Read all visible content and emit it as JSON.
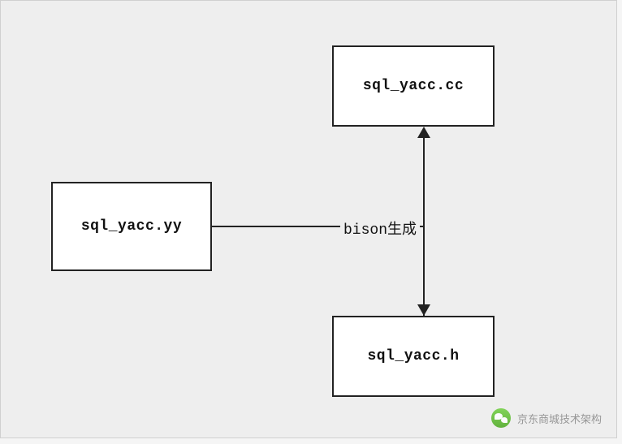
{
  "nodes": {
    "source": "sql_yacc.yy",
    "output_cc": "sql_yacc.cc",
    "output_h": "sql_yacc.h"
  },
  "edge_label": "bison生成",
  "watermark": {
    "icon": "wechat-icon",
    "text": "京东商城技术架构"
  }
}
